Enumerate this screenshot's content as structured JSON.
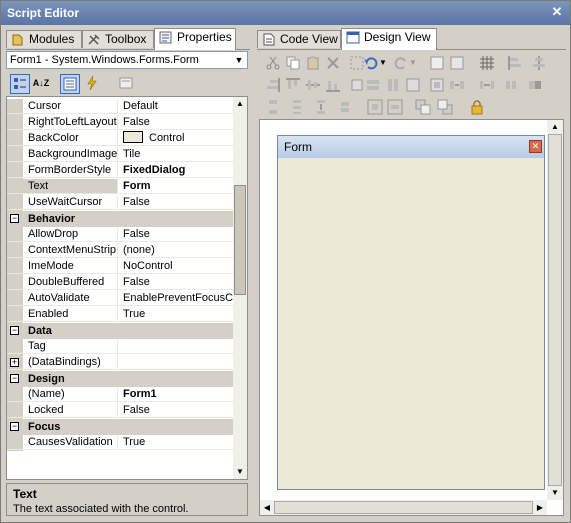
{
  "window": {
    "title": "Script Editor",
    "close_glyph": "✕"
  },
  "left_tabs": [
    {
      "label": "Modules",
      "icon": "modules-icon"
    },
    {
      "label": "Toolbox",
      "icon": "toolbox-icon"
    },
    {
      "label": "Properties",
      "icon": "properties-icon",
      "active": true
    }
  ],
  "object_selector": {
    "value": "Form1  -  System.Windows.Forms.Form"
  },
  "property_toolbar": {
    "sort_az_label": "A↓Z"
  },
  "properties": {
    "rows": [
      {
        "type": "prop",
        "name": "Cursor",
        "value": "Default"
      },
      {
        "type": "prop",
        "name": "RightToLeftLayout",
        "value": "False"
      },
      {
        "type": "prop",
        "name": "BackColor",
        "value": "Control",
        "swatch": true
      },
      {
        "type": "prop",
        "name": "BackgroundImage",
        "value": "Tile"
      },
      {
        "type": "prop",
        "name": "FormBorderStyle",
        "value": "FixedDialog",
        "bold": true
      },
      {
        "type": "prop",
        "name": "Text",
        "value": "Form",
        "bold": true,
        "selected": true
      },
      {
        "type": "prop",
        "name": "UseWaitCursor",
        "value": "False"
      },
      {
        "type": "cat",
        "name": "Behavior"
      },
      {
        "type": "prop",
        "name": "AllowDrop",
        "value": "False"
      },
      {
        "type": "prop",
        "name": "ContextMenuStrip",
        "value": "(none)"
      },
      {
        "type": "prop",
        "name": "ImeMode",
        "value": "NoControl"
      },
      {
        "type": "prop",
        "name": "DoubleBuffered",
        "value": "False"
      },
      {
        "type": "prop",
        "name": "AutoValidate",
        "value": "EnablePreventFocusChange"
      },
      {
        "type": "prop",
        "name": "Enabled",
        "value": "True"
      },
      {
        "type": "cat",
        "name": "Data"
      },
      {
        "type": "prop",
        "name": "Tag",
        "value": ""
      },
      {
        "type": "prop",
        "name": "(DataBindings)",
        "value": "",
        "expand": true
      },
      {
        "type": "cat",
        "name": "Design"
      },
      {
        "type": "prop",
        "name": "(Name)",
        "value": "Form1",
        "bold": true
      },
      {
        "type": "prop",
        "name": "Locked",
        "value": "False"
      },
      {
        "type": "cat",
        "name": "Focus"
      },
      {
        "type": "prop",
        "name": "CausesValidation",
        "value": "True"
      }
    ]
  },
  "description": {
    "title": "Text",
    "text": "The text associated with the control."
  },
  "right_tabs": [
    {
      "label": "Code View",
      "icon": "code-view-icon"
    },
    {
      "label": "Design View",
      "icon": "design-view-icon",
      "active": true
    }
  ],
  "design": {
    "form_title": "Form"
  }
}
